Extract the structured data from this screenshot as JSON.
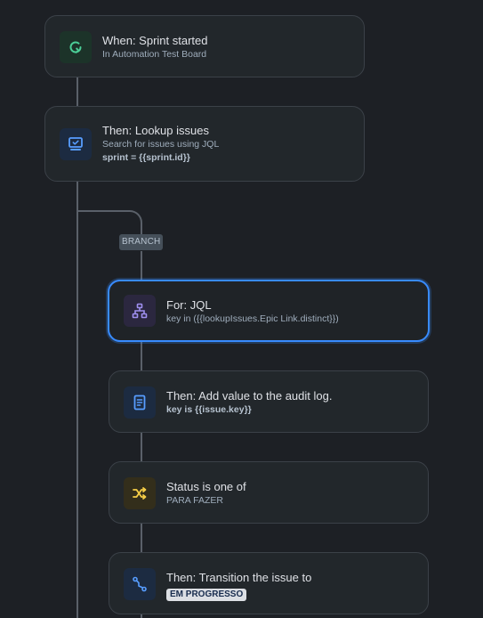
{
  "flow": {
    "trigger": {
      "title": "When: Sprint started",
      "subtitle": "In Automation Test Board"
    },
    "lookup": {
      "title": "Then: Lookup issues",
      "subtitle": "Search for issues using JQL",
      "detail": "sprint = {{sprint.id}}"
    },
    "branch_label": "BRANCH",
    "for_jql": {
      "title": "For: JQL",
      "subtitle": "key in ({{lookupIssues.Epic Link.distinct}})"
    },
    "audit_log": {
      "title": "Then: Add value to the audit log.",
      "detail": "key is {{issue.key}}"
    },
    "condition": {
      "title": "Status is one of",
      "subtitle": "PARA FAZER"
    },
    "transition": {
      "title": "Then: Transition the issue to",
      "status": "EM PROGRESSO"
    }
  },
  "icons": {
    "trigger": "refresh-icon",
    "lookup": "monitor-check-icon",
    "for_jql": "hierarchy-icon",
    "audit_log": "document-icon",
    "condition": "shuffle-icon",
    "transition": "path-icon"
  },
  "colors": {
    "background": "#1d2025",
    "card": "#22272b",
    "selected_border": "#388bff",
    "connector": "#5a6069",
    "trigger_icon": "#4bce97",
    "action_icon": "#579dff",
    "branch_icon": "#9f8fef",
    "condition_icon": "#f5cd47"
  }
}
